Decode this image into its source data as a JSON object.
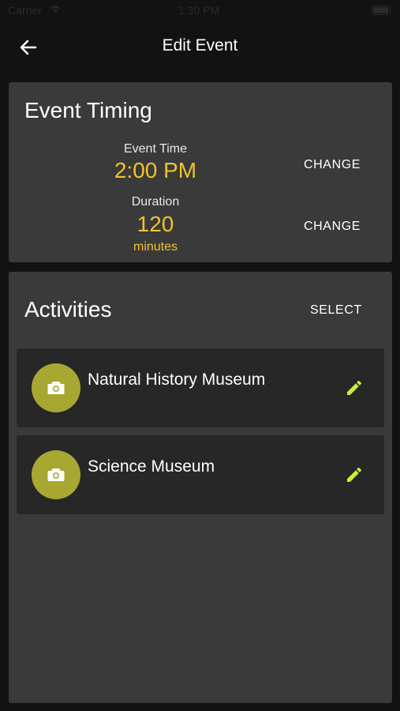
{
  "status_bar": {
    "carrier": "Carrier",
    "time": "1:30 PM"
  },
  "app_bar": {
    "title": "Edit Event"
  },
  "timing": {
    "title": "Event Timing",
    "event_time_label": "Event Time",
    "event_time_value": "2:00 PM",
    "duration_label": "Duration",
    "duration_value": "120",
    "duration_unit": "minutes",
    "change_time_label": "CHANGE",
    "change_duration_label": "CHANGE"
  },
  "activities": {
    "title": "Activities",
    "select_label": "SELECT",
    "items": [
      {
        "name": "Natural History Museum",
        "icon": "camera-icon"
      },
      {
        "name": "Science Museum",
        "icon": "camera-icon"
      }
    ]
  },
  "colors": {
    "accent": "#f1c232",
    "avatar": "#a8a732",
    "edit_icon": "#c6f03c",
    "card": "#3a3a3a",
    "background": "#121212"
  }
}
